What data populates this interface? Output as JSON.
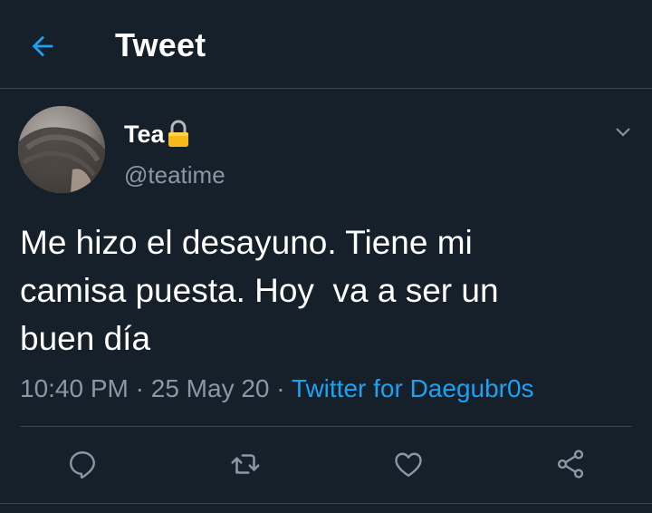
{
  "header": {
    "title": "Tweet",
    "back_icon": "arrow-left-icon"
  },
  "tweet": {
    "author_name": "Tea",
    "handle": "@teatime",
    "protected_icon": "lock-icon",
    "text": "Me hizo el desayuno. Tiene mi\ncamisa puesta. Hoy  va a ser un\nbuen día",
    "time": "10:40 PM",
    "separator_1": " · ",
    "date": "25 May 20",
    "separator_2": " · ",
    "source": "Twitter for Daegubr0s"
  },
  "actions": {
    "reply_icon": "reply-icon",
    "retweet_icon": "retweet-icon",
    "like_icon": "heart-icon",
    "share_icon": "share-icon"
  },
  "colors": {
    "background": "#15202b",
    "accent": "#1da1f2",
    "muted": "#8899a6",
    "divider": "#38444d"
  }
}
